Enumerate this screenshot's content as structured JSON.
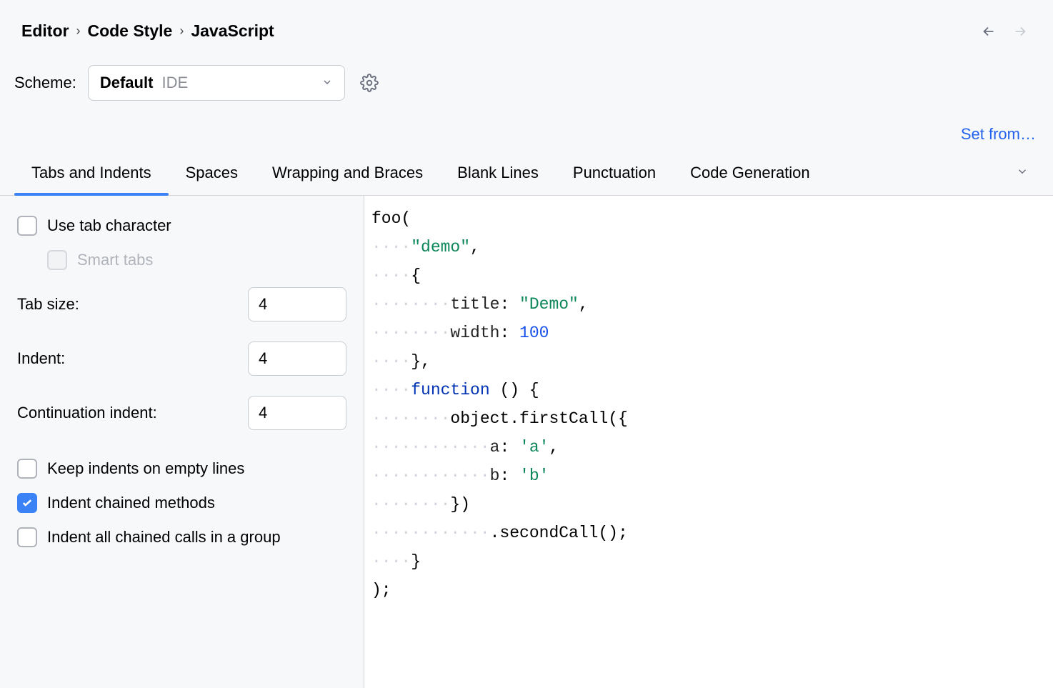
{
  "breadcrumb": [
    "Editor",
    "Code Style",
    "JavaScript"
  ],
  "scheme": {
    "label": "Scheme:",
    "name": "Default",
    "tag": "IDE"
  },
  "setfrom": "Set from…",
  "tabs": [
    "Tabs and Indents",
    "Spaces",
    "Wrapping and Braces",
    "Blank Lines",
    "Punctuation",
    "Code Generation"
  ],
  "active_tab": 0,
  "options": {
    "use_tab_character": {
      "label": "Use tab character",
      "checked": false
    },
    "smart_tabs": {
      "label": "Smart tabs",
      "checked": false,
      "disabled": true
    },
    "tab_size": {
      "label": "Tab size:",
      "value": "4"
    },
    "indent": {
      "label": "Indent:",
      "value": "4"
    },
    "continuation_indent": {
      "label": "Continuation indent:",
      "value": "4"
    },
    "keep_indents_empty": {
      "label": "Keep indents on empty lines",
      "checked": false
    },
    "indent_chained_methods": {
      "label": "Indent chained methods",
      "checked": true
    },
    "indent_all_chained_group": {
      "label": "Indent all chained calls in a group",
      "checked": false
    }
  },
  "code_preview": {
    "lines": [
      {
        "ws": "",
        "segs": [
          {
            "t": "plain",
            "v": "foo("
          }
        ]
      },
      {
        "ws": "····",
        "segs": [
          {
            "t": "str",
            "v": "\"demo\""
          },
          {
            "t": "plain",
            "v": ","
          }
        ]
      },
      {
        "ws": "····",
        "segs": [
          {
            "t": "plain",
            "v": "{"
          }
        ]
      },
      {
        "ws": "········",
        "segs": [
          {
            "t": "prop",
            "v": "title"
          },
          {
            "t": "plain",
            "v": ": "
          },
          {
            "t": "str",
            "v": "\"Demo\""
          },
          {
            "t": "plain",
            "v": ","
          }
        ]
      },
      {
        "ws": "········",
        "segs": [
          {
            "t": "prop",
            "v": "width"
          },
          {
            "t": "plain",
            "v": ": "
          },
          {
            "t": "num",
            "v": "100"
          }
        ]
      },
      {
        "ws": "····",
        "segs": [
          {
            "t": "plain",
            "v": "},"
          }
        ]
      },
      {
        "ws": "····",
        "segs": [
          {
            "t": "kw",
            "v": "function"
          },
          {
            "t": "plain",
            "v": " () {"
          }
        ]
      },
      {
        "ws": "········",
        "segs": [
          {
            "t": "plain",
            "v": "object.firstCall({"
          }
        ]
      },
      {
        "ws": "············",
        "segs": [
          {
            "t": "prop",
            "v": "a"
          },
          {
            "t": "plain",
            "v": ": "
          },
          {
            "t": "str",
            "v": "'a'"
          },
          {
            "t": "plain",
            "v": ","
          }
        ]
      },
      {
        "ws": "············",
        "segs": [
          {
            "t": "prop",
            "v": "b"
          },
          {
            "t": "plain",
            "v": ": "
          },
          {
            "t": "str",
            "v": "'b'"
          }
        ]
      },
      {
        "ws": "········",
        "segs": [
          {
            "t": "plain",
            "v": "})"
          }
        ]
      },
      {
        "ws": "············",
        "segs": [
          {
            "t": "plain",
            "v": ".secondCall();"
          }
        ]
      },
      {
        "ws": "····",
        "segs": [
          {
            "t": "plain",
            "v": "}"
          }
        ]
      },
      {
        "ws": "",
        "segs": [
          {
            "t": "plain",
            "v": ");"
          }
        ]
      }
    ]
  }
}
